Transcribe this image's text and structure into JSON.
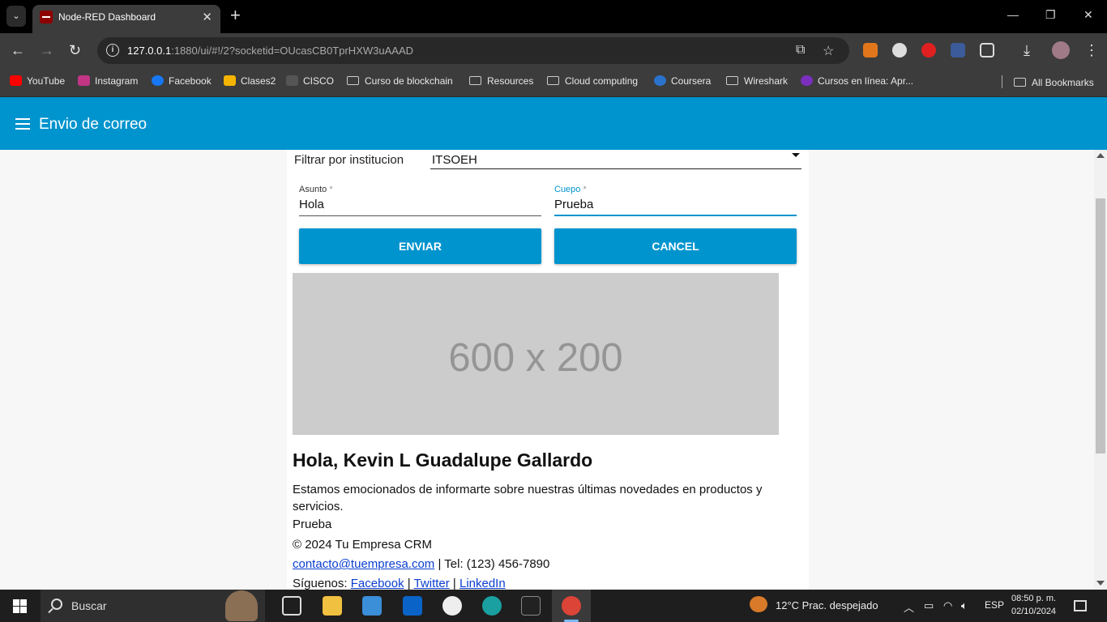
{
  "browser": {
    "tab_title": "Node-RED Dashboard",
    "url_host": "127.0.0.1",
    "url_rest": ":1880/ui/#!/2?socketid=OUcasCB0TprHXW3uAAAD",
    "bookmarks": [
      "YouTube",
      "Instagram",
      "Facebook",
      "Clases2",
      "CISCO",
      "Curso de blockchain",
      "Resources",
      "Cloud computing",
      "Coursera",
      "Wireshark",
      "Cursos en línea: Apr...",
      "All Bookmarks"
    ]
  },
  "app": {
    "title": "Envio de correo"
  },
  "form": {
    "filter_label": "Filtrar por institucion",
    "filter_value": "ITSOEH",
    "asunto_label": "Asunto",
    "asunto_value": "Hola",
    "cuerpo_label": "Cuepo",
    "cuerpo_value": "Prueba",
    "required_mark": "*",
    "send_label": "ENVIAR",
    "cancel_label": "CANCEL"
  },
  "email": {
    "image_text": "600 x 200",
    "greeting": "Hola, Kevin L Guadalupe Gallardo",
    "intro": "Estamos emocionados de informarte sobre nuestras últimas novedades en productos y servicios.",
    "body": "Prueba",
    "copyright": "© 2024 Tu Empresa CRM",
    "contact_email": "contacto@tuempresa.com",
    "phone": " | Tel: (123) 456-7890",
    "follow_label": "Síguenos: ",
    "social": [
      "Facebook",
      "Twitter",
      "LinkedIn"
    ],
    "separator": " | "
  },
  "taskbar": {
    "search_placeholder": "Buscar",
    "weather": "12°C  Prac. despejado",
    "language": "ESP",
    "time": "08:50 p. m.",
    "date": "02/10/2024"
  },
  "colors": {
    "accent": "#0094ce",
    "link": "#0b3ed1"
  }
}
